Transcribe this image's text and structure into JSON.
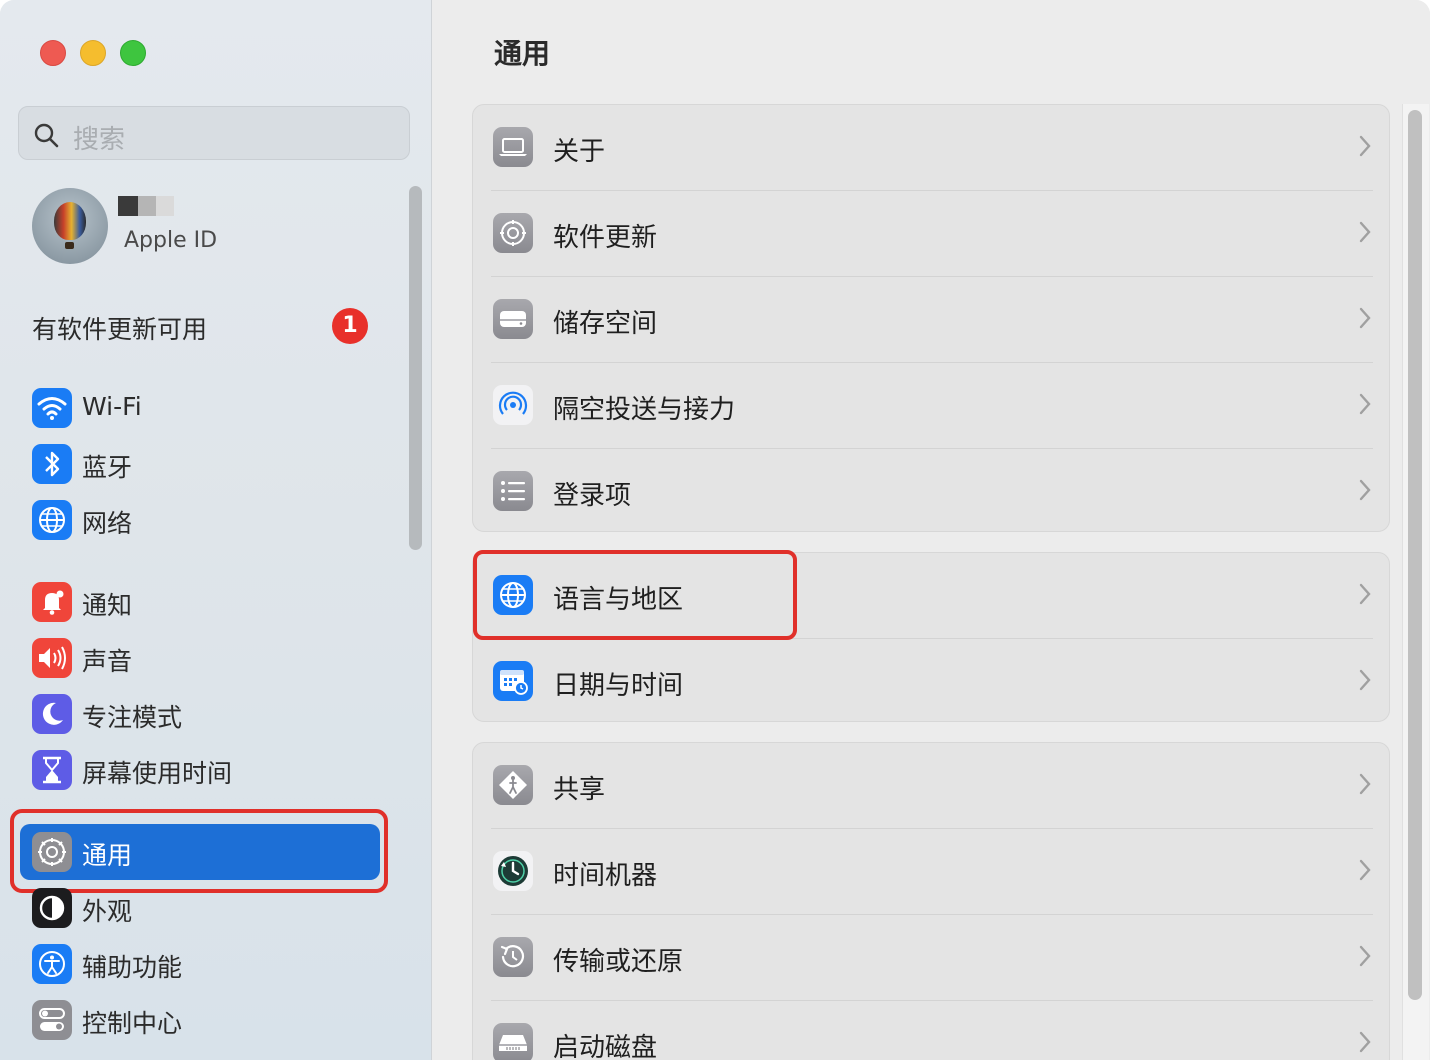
{
  "window": {
    "title": "通用"
  },
  "sidebar": {
    "search_placeholder": "搜索",
    "account": {
      "subtitle": "Apple ID"
    },
    "update": {
      "label": "有软件更新可用",
      "badge": "1"
    },
    "items": [
      {
        "label": "Wi-Fi",
        "icon": "wifi-icon",
        "color": "#1a7cf5"
      },
      {
        "label": "蓝牙",
        "icon": "bluetooth-icon",
        "color": "#1a7cf5"
      },
      {
        "label": "网络",
        "icon": "globe-icon",
        "color": "#1a7cf5"
      },
      {
        "label": "通知",
        "icon": "bell-icon",
        "color": "#f0453a"
      },
      {
        "label": "声音",
        "icon": "speaker-icon",
        "color": "#f0453a"
      },
      {
        "label": "专注模式",
        "icon": "moon-icon",
        "color": "#5e5ce6"
      },
      {
        "label": "屏幕使用时间",
        "icon": "hourglass-icon",
        "color": "#5e5ce6"
      },
      {
        "label": "通用",
        "icon": "gear-icon",
        "color": "#8e8e93",
        "selected": true
      },
      {
        "label": "外观",
        "icon": "appearance-icon",
        "color": "#1c1c1e"
      },
      {
        "label": "辅助功能",
        "icon": "accessibility-icon",
        "color": "#1a7cf5"
      },
      {
        "label": "控制中心",
        "icon": "toggles-icon",
        "color": "#8e8e93"
      }
    ]
  },
  "main": {
    "title": "通用",
    "groups": [
      {
        "rows": [
          {
            "label": "关于",
            "icon": "laptop-icon"
          },
          {
            "label": "软件更新",
            "icon": "gear-badge-icon"
          },
          {
            "label": "储存空间",
            "icon": "drive-icon"
          },
          {
            "label": "隔空投送与接力",
            "icon": "airdrop-icon"
          },
          {
            "label": "登录项",
            "icon": "list-icon"
          }
        ]
      },
      {
        "rows": [
          {
            "label": "语言与地区",
            "icon": "globe-icon",
            "highlighted": true
          },
          {
            "label": "日期与时间",
            "icon": "calendar-clock-icon"
          }
        ]
      },
      {
        "rows": [
          {
            "label": "共享",
            "icon": "sharing-icon"
          },
          {
            "label": "时间机器",
            "icon": "time-machine-icon"
          },
          {
            "label": "传输或还原",
            "icon": "restore-icon"
          },
          {
            "label": "启动磁盘",
            "icon": "startup-disk-icon"
          }
        ]
      }
    ]
  },
  "colors": {
    "accent": "#1d6fd6",
    "highlight_outline": "#e0302a",
    "badge": "#e8302a"
  }
}
